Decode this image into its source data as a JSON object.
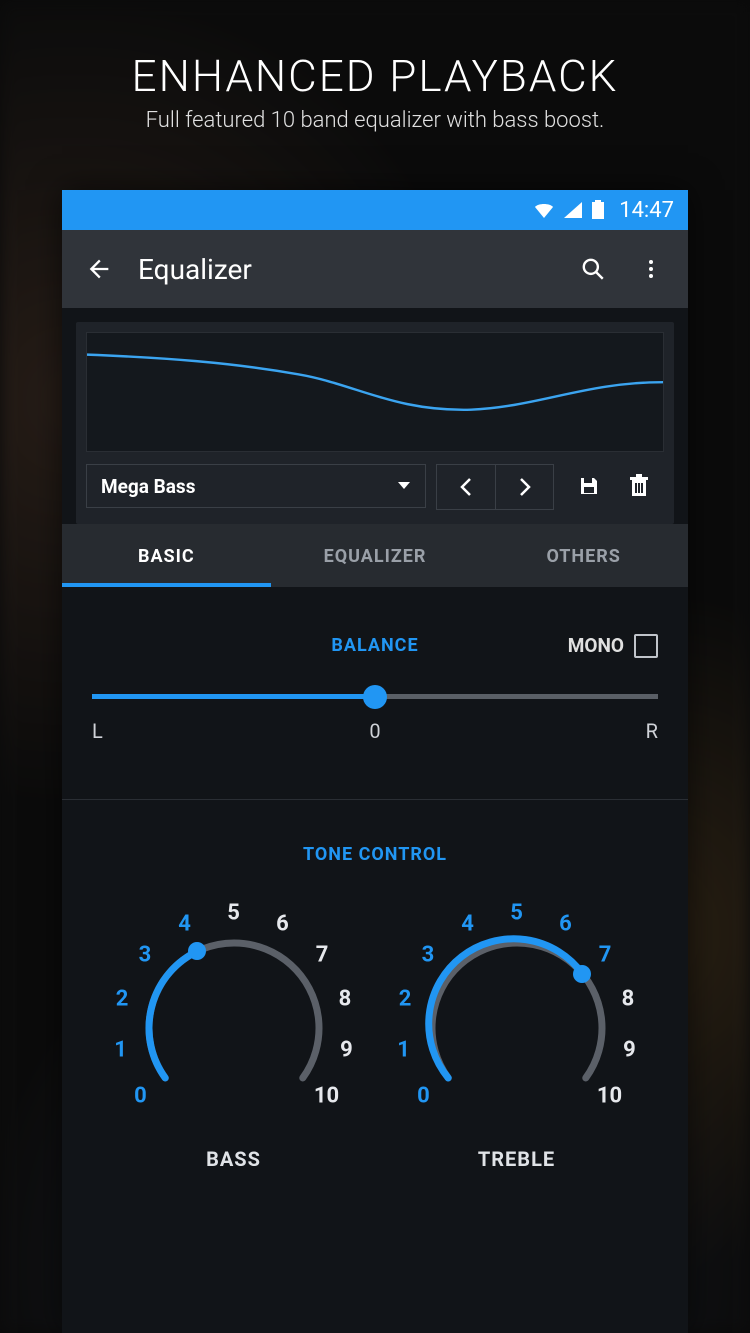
{
  "promo": {
    "title": "ENHANCED PLAYBACK",
    "subtitle": "Full featured 10 band equalizer with bass boost."
  },
  "status": {
    "time": "14:47"
  },
  "appbar": {
    "title": "Equalizer"
  },
  "preset": {
    "selected": "Mega Bass"
  },
  "tabs": {
    "items": [
      {
        "label": "BASIC",
        "active": true
      },
      {
        "label": "EQUALIZER",
        "active": false
      },
      {
        "label": "OTHERS",
        "active": false
      }
    ]
  },
  "balance": {
    "title": "BALANCE",
    "mono_label": "MONO",
    "mono_checked": false,
    "value": 0,
    "left_label": "L",
    "center_label": "0",
    "right_label": "R"
  },
  "tone": {
    "title": "TONE CONTROL",
    "dials": [
      {
        "label": "BASS",
        "value": 4,
        "min": 0,
        "max": 10
      },
      {
        "label": "TREBLE",
        "value": 7,
        "min": 0,
        "max": 10
      }
    ]
  },
  "icons": {
    "back": "back-arrow-icon",
    "search": "search-icon",
    "more": "more-vert-icon",
    "dropdown": "caret-down-icon",
    "prev": "chevron-left-icon",
    "next": "chevron-right-icon",
    "save": "save-icon",
    "delete": "delete-icon",
    "wifi": "wifi-icon",
    "signal": "signal-icon",
    "battery": "battery-icon"
  }
}
